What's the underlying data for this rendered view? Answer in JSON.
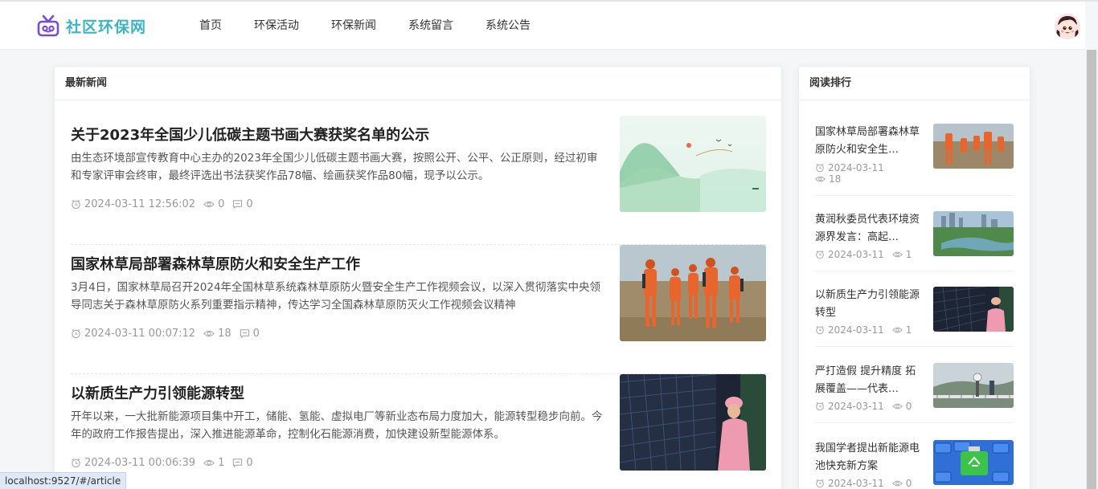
{
  "app": {
    "name": "社区环保网"
  },
  "nav": [
    "首页",
    "环保活动",
    "环保新闻",
    "系统留言",
    "系统公告"
  ],
  "main": {
    "heading": "最新新闻",
    "articles": [
      {
        "title": "关于2023年全国少儿低碳主题书画大赛获奖名单的公示",
        "desc": "由生态环境部宣传教育中心主办的2023年全国少儿低碳主题书画大赛，按照公开、公平、公正原则，经过初审和专家评审会终审，最终评选出书法获奖作品78幅、绘画获奖作品80幅，现予以公示。",
        "time": "2024-03-11 12:56:02",
        "views": "0",
        "comments": "0",
        "image": "landscape-painting"
      },
      {
        "title": "国家林草局部署森林草原防火和安全生产工作",
        "desc": "3月4日，国家林草局召开2024年全国林草系统森林草原防火暨安全生产工作视频会议，以深入贯彻落实中央领导同志关于森林草原防火系列重要指示精神，传达学习全国森林草原防灭火工作视频会议精神",
        "time": "2024-03-11 00:07:12",
        "views": "18",
        "comments": "0",
        "image": "firefighters"
      },
      {
        "title": "以新质生产力引领能源转型",
        "desc": "开年以来，一大批新能源项目集中开工，储能、氢能、虚拟电厂等新业态布局力度加大，能源转型稳步向前。今年的政府工作报告提出，深入推进能源革命，控制化石能源消费，加快建设新型能源体系。",
        "time": "2024-03-11 00:06:39",
        "views": "1",
        "comments": "0",
        "image": "solar-panel-worker"
      }
    ]
  },
  "side": {
    "heading": "阅读排行",
    "items": [
      {
        "title": "国家林草局部署森林草原防火和安全生…",
        "time": "2024-03-11",
        "views": "18",
        "image": "firefighters"
      },
      {
        "title": "黄润秋委员代表环境资源界发言：高起…",
        "time": "2024-03-11",
        "views": "1",
        "image": "city-lake"
      },
      {
        "title": "以新质生产力引领能源转型",
        "time": "2024-03-11",
        "views": "1",
        "image": "solar-panel-worker"
      },
      {
        "title": "严打造假 提升精度 拓展覆盖——代表…",
        "time": "2024-03-11",
        "views": "0",
        "image": "monitoring-station"
      },
      {
        "title": "我国学者提出新能源电池快充新方案",
        "time": "2024-03-11",
        "views": "0",
        "image": "batteries"
      }
    ]
  },
  "status_url": "localhost:9527/#/article",
  "colors": {
    "brand": "#3bb4c7",
    "logo_icon": "#7b4bd8"
  }
}
